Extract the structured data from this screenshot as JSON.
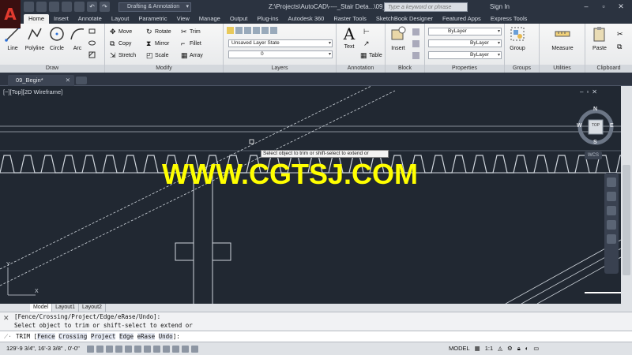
{
  "titlebar": {
    "workspace": "Drafting & Annotation",
    "doc_title": "Z:\\Projects\\AutoCAD\\----_Stair Deta...\\09_Begin.dwg",
    "search_placeholder": "Type a keyword or phrase",
    "signin": "Sign In"
  },
  "ribbon_tabs": [
    "Home",
    "Insert",
    "Annotate",
    "Layout",
    "Parametric",
    "View",
    "Manage",
    "Output",
    "Plug-ins",
    "Autodesk 360",
    "Raster Tools",
    "SketchBook Designer",
    "Featured Apps",
    "Express Tools"
  ],
  "draw": {
    "title": "Draw",
    "line": "Line",
    "polyline": "Polyline",
    "circle": "Circle",
    "arc": "Arc"
  },
  "modify": {
    "title": "Modify",
    "move": "Move",
    "rotate": "Rotate",
    "trim": "Trim",
    "copy": "Copy",
    "mirror": "Mirror",
    "fillet": "Fillet",
    "stretch": "Stretch",
    "scale": "Scale",
    "array": "Array"
  },
  "layers": {
    "title": "Layers",
    "state": "Unsaved Layer State",
    "current": "0"
  },
  "annotation": {
    "title": "Annotation",
    "text": "Text",
    "table": "Table"
  },
  "block": {
    "title": "Block",
    "insert": "Insert"
  },
  "properties": {
    "title": "Properties",
    "color": "ByLayer",
    "linetype": "ByLayer",
    "lineweight": "ByLayer"
  },
  "groups": {
    "title": "Groups",
    "group": "Group"
  },
  "utilities": {
    "title": "Utilities",
    "measure": "Measure"
  },
  "clipboard": {
    "title": "Clipboard",
    "paste": "Paste"
  },
  "file_tab": "09_Begin*",
  "viewport_label": "[−][Top][2D Wireframe]",
  "viewcube": {
    "n": "N",
    "s": "S",
    "e": "E",
    "w": "W",
    "top": "TOP",
    "wcs": "WCS"
  },
  "tooltip": "Select object to trim or shift-select to extend or",
  "watermark": "WWW.CGTSJ.COM",
  "layout_tabs": [
    "Model",
    "Layout1",
    "Layout2"
  ],
  "command_history": [
    "[Fence/Crossing/Project/Edge/eRase/Undo]:",
    "Select object to trim or shift-select to extend or"
  ],
  "command_line": {
    "cmd": "TRIM",
    "options": [
      "Fence",
      "Crossing",
      "Project",
      "Edge",
      "eRase",
      "Undo"
    ]
  },
  "statusbar": {
    "coords": "129'-9 3/4\",  16'-3 3/8\" , 0'-0\"",
    "model": "MODEL",
    "scale": "1:1"
  },
  "colors": {
    "canvas": "#212832",
    "watermark": "#ffff00",
    "accent": "#e13a2f"
  }
}
